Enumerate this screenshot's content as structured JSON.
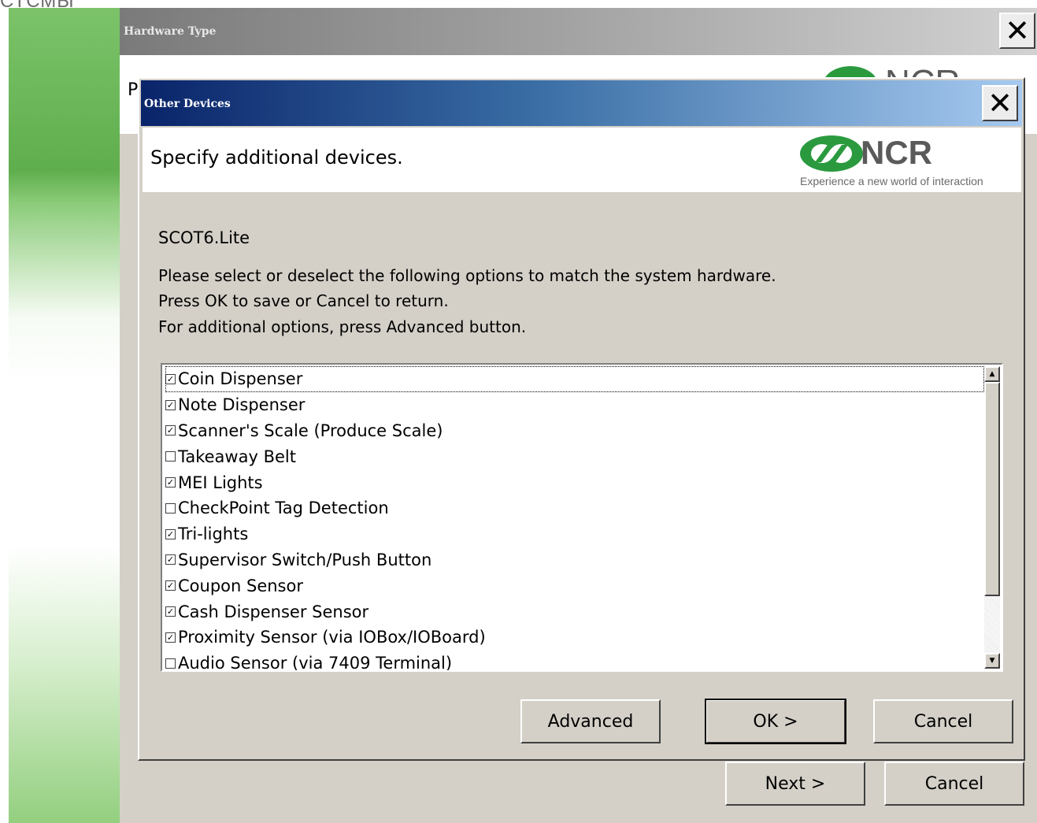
{
  "corner_text": "СТСМЫ",
  "outer_window": {
    "title": "Hardware Type",
    "header_letter": "P",
    "logo_text": "NCR",
    "next_label": "Next >",
    "cancel_label": "Cancel"
  },
  "dialog": {
    "title": "Other Devices",
    "header": "Specify additional devices.",
    "logo": {
      "text": "NCR",
      "tagline": "Experience a new world of interaction",
      "color": "#2b9a3f"
    },
    "profile": "SCOT6.Lite",
    "instructions": [
      "Please select or deselect the following options to match the system hardware.",
      "Press OK to save or Cancel to return.",
      "For additional options, press Advanced button."
    ],
    "devices": [
      {
        "label": "Coin Dispenser",
        "checked": true
      },
      {
        "label": "Note Dispenser",
        "checked": true
      },
      {
        "label": "Scanner's Scale (Produce Scale)",
        "checked": true
      },
      {
        "label": "Takeaway Belt",
        "checked": false
      },
      {
        "label": "MEI Lights",
        "checked": true
      },
      {
        "label": "CheckPoint Tag Detection",
        "checked": false
      },
      {
        "label": "Tri-lights",
        "checked": true
      },
      {
        "label": "Supervisor Switch/Push Button",
        "checked": true
      },
      {
        "label": "Coupon Sensor",
        "checked": true
      },
      {
        "label": "Cash Dispenser Sensor",
        "checked": true
      },
      {
        "label": "Proximity Sensor (via IOBox/IOBoard)",
        "checked": true
      },
      {
        "label": "Audio Sensor (via 7409 Terminal)",
        "checked": false
      }
    ],
    "buttons": {
      "advanced": "Advanced",
      "ok": "OK >",
      "cancel": "Cancel"
    }
  },
  "colors": {
    "title_gradient_start": "#0a246a",
    "title_gradient_end": "#a6caf0",
    "window_bg": "#d4d0c8",
    "side_panel_green": "#5fae4d"
  }
}
